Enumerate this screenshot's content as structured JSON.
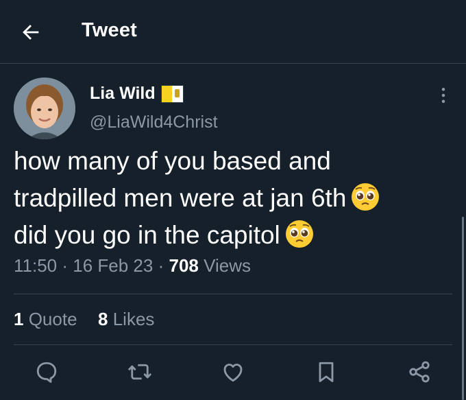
{
  "header": {
    "title": "Tweet",
    "back_icon": "arrow-left-icon"
  },
  "tweet": {
    "author_name": "Lia Wild",
    "author_handle": "@LiaWild4Christ",
    "text_lines": [
      "how many of you based and",
      "tradpilled men were at jan 6th",
      "did you go in the capitol"
    ],
    "emoji": "pleading-face-emoji",
    "time": "11:50",
    "date": "16 Feb 23",
    "views_count": "708",
    "views_label": "Views",
    "quotes_count": "1",
    "quotes_label": "Quote",
    "likes_count": "8",
    "likes_label": "Likes"
  },
  "colors": {
    "background": "#15202b",
    "text": "#ffffff",
    "muted": "#8b98a5",
    "divider": "#38444d",
    "icon": "#8b98a5"
  }
}
